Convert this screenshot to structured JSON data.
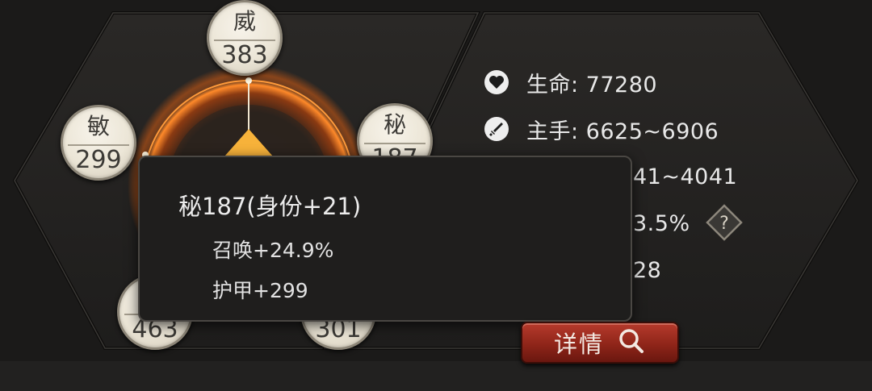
{
  "attribute_wheel": {
    "nodes": [
      {
        "label": "威",
        "value": "383"
      },
      {
        "label": "敏",
        "value": "299"
      },
      {
        "label": "秘",
        "value": "187"
      },
      {
        "label": "",
        "value": "463"
      },
      {
        "label": "",
        "value": "301"
      }
    ]
  },
  "stats": [
    {
      "icon": "heart-icon",
      "text": "生命: 77280"
    },
    {
      "icon": "sword-icon",
      "text": "主手: 6625~6906"
    },
    {
      "icon": "",
      "text": "41~4041"
    },
    {
      "icon": "",
      "text": "3.5%"
    },
    {
      "icon": "",
      "text": "28"
    }
  ],
  "help_icon": {
    "symbol": "?"
  },
  "tooltip": {
    "title": "秘187(身份+21)",
    "lines": [
      "召唤+24.9%",
      "护甲+299"
    ]
  },
  "details_button": {
    "label": "详情",
    "icon": "search-icon"
  },
  "colors": {
    "background": "#1a1918",
    "glow": "#ff7a1a",
    "button": "#9e2a1e",
    "node_fill": "#ece6d7"
  }
}
